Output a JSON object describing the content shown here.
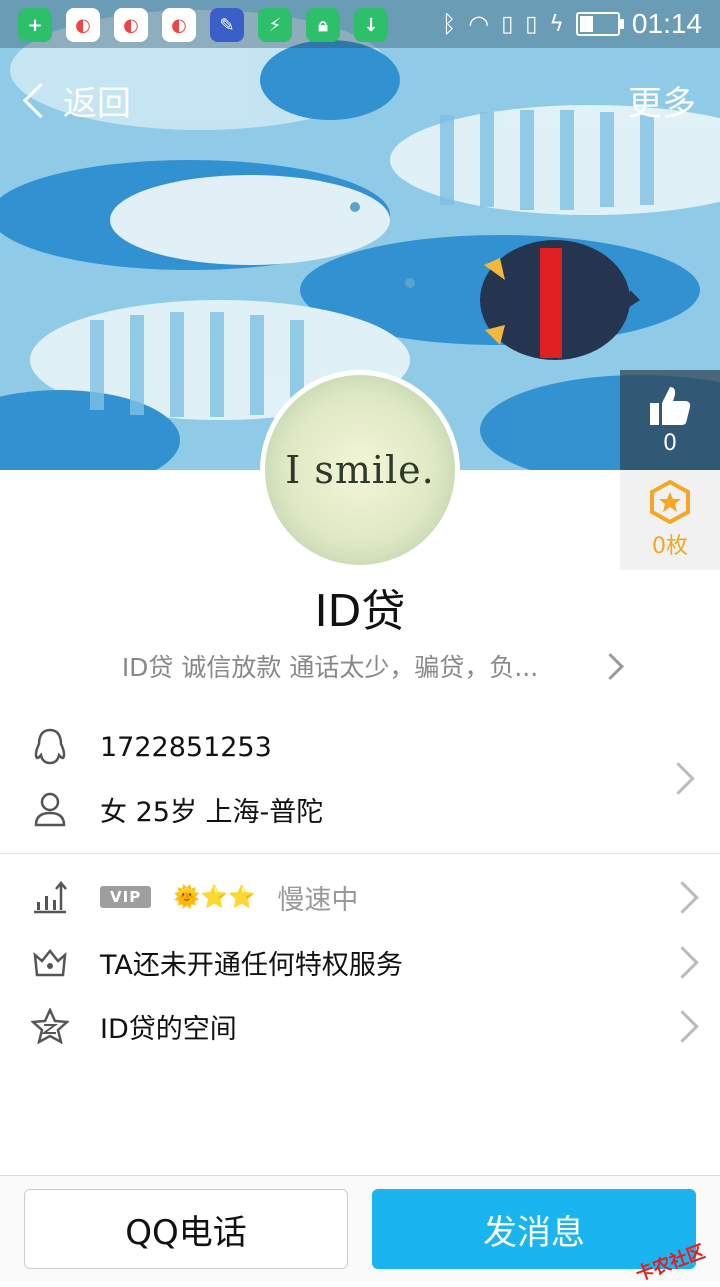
{
  "status_bar": {
    "time": "01:14",
    "battery_level": 0.35,
    "app_icons": [
      "plus-app-icon",
      "browser-app-icon",
      "browser-app-icon",
      "browser-app-icon",
      "tool-app-icon",
      "shield-app-icon",
      "lock-app-icon",
      "download-app-icon"
    ],
    "system_icons": [
      "bluetooth-icon",
      "wifi-icon",
      "sim1-icon",
      "sim2-icon",
      "charging-icon",
      "battery-icon"
    ]
  },
  "nav": {
    "back_label": "返回",
    "more_label": "更多"
  },
  "like": {
    "count": "0"
  },
  "coin": {
    "count": "0枚"
  },
  "avatar": {
    "text": "I smile."
  },
  "profile": {
    "nickname": "ID贷",
    "signature": "ID贷 诚信放款 通话太少，骗贷，负..."
  },
  "info": {
    "qq_number": "1722851253",
    "basic": "女  25岁  上海-普陀"
  },
  "level_row": {
    "vip": "VIP",
    "level_icons": "🌞⭐⭐",
    "speed": "慢速中"
  },
  "privilege_row": {
    "label": "TA还未开通任何特权服务"
  },
  "space_row": {
    "label": "ID贷的空间"
  },
  "buttons": {
    "call": "QQ电话",
    "message": "发消息"
  },
  "watermark": "卡农社区",
  "colors": {
    "accent": "#1ab4f0",
    "coin": "#f5a623"
  }
}
